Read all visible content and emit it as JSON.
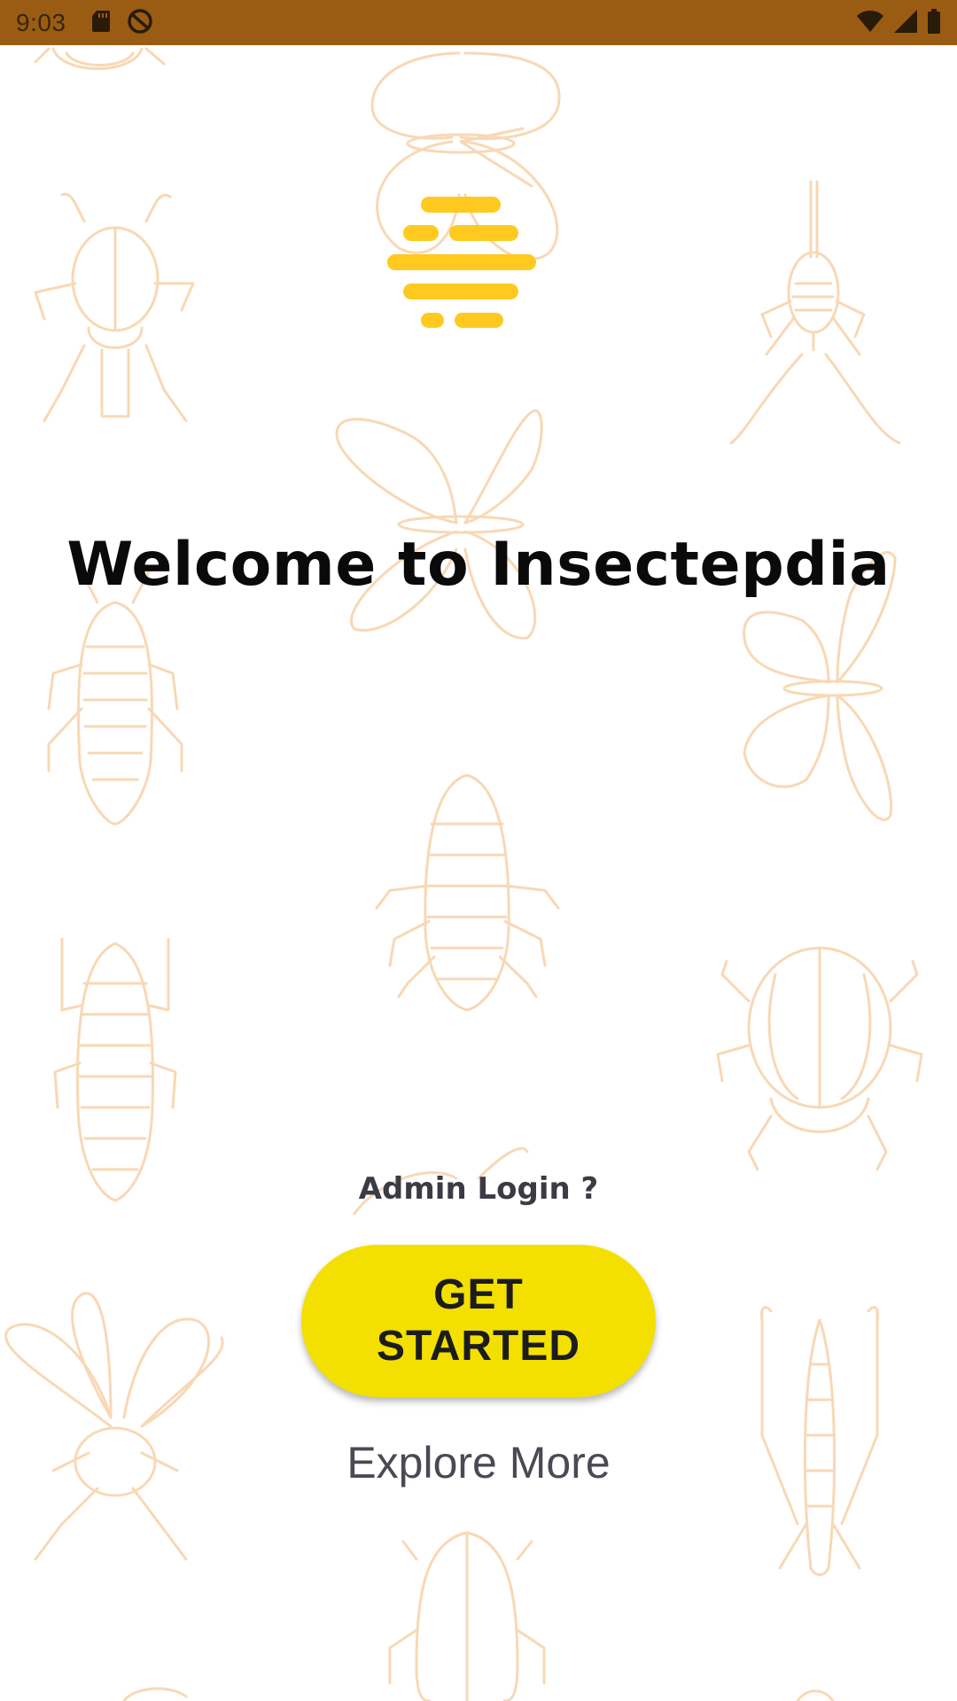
{
  "status_bar": {
    "time": "9:03",
    "bg_color": "#9a5c12"
  },
  "main": {
    "welcome_title": "Welcome to Insectepdia",
    "admin_login_label": "Admin Login ?",
    "get_started_label": "GET STARTED",
    "explore_more_label": "Explore More"
  },
  "colors": {
    "accent_yellow": "#f3e000",
    "logo_yellow": "#ffc91f",
    "outline_peach": "#f8d8b5"
  },
  "icons": {
    "status_left": [
      "sd-card-icon",
      "do-not-disturb-icon"
    ],
    "status_right": [
      "wifi-icon",
      "cell-signal-icon",
      "battery-icon"
    ],
    "app_logo": "bee-stripes-logo-icon"
  }
}
